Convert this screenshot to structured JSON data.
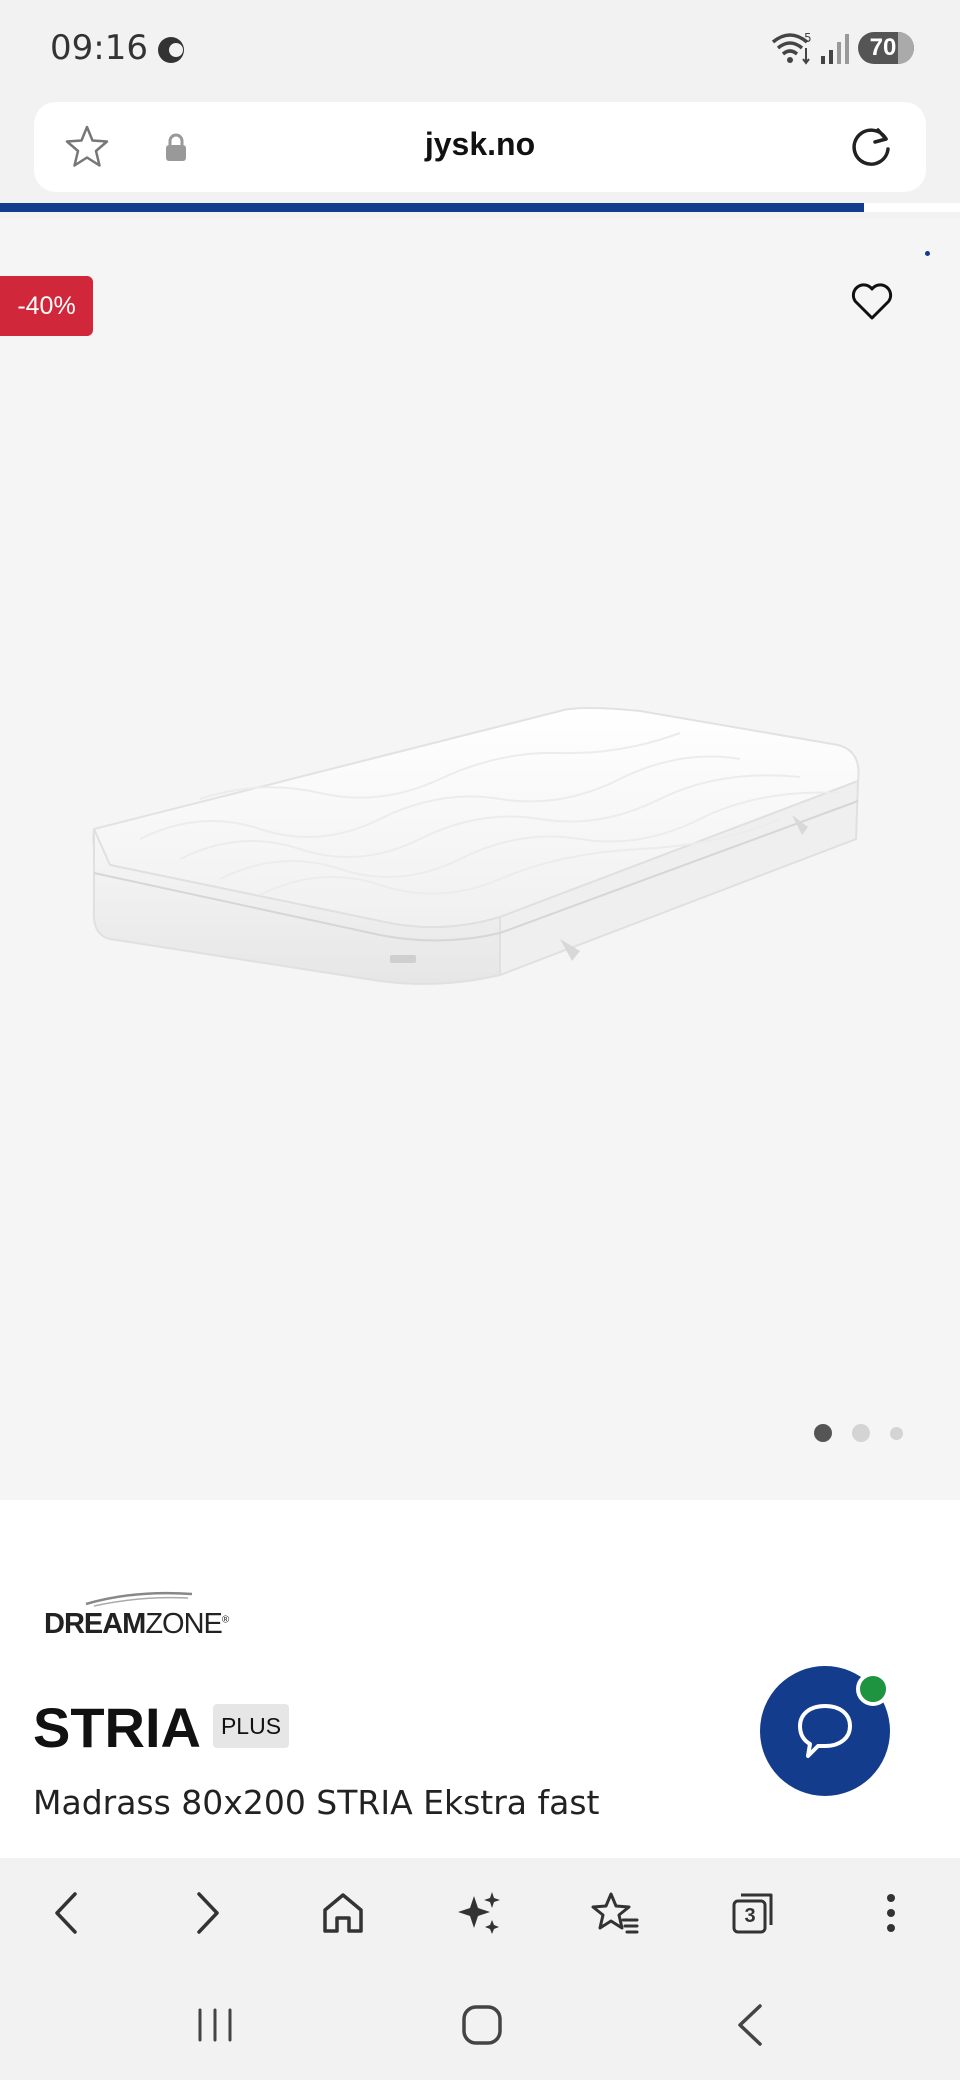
{
  "status_bar": {
    "time": "09:16",
    "wifi_label": "5",
    "battery": "70"
  },
  "address_bar": {
    "url": "jysk.no"
  },
  "page_load_progress": 0.9,
  "gallery": {
    "discount_badge": "-40%",
    "image_count": 3,
    "active_image_index": 0
  },
  "product": {
    "brand": "DREAMZONE",
    "brand_bold": "DREAM",
    "brand_light": "ZONE",
    "title": "STRIA",
    "tag": "PLUS",
    "subtitle": "Madrass 80x200 STRIA Ekstra fast"
  },
  "browser_toolbar": {
    "tab_count": "3",
    "icons": [
      "back-icon",
      "forward-icon",
      "home-icon",
      "ai-sparkle-icon",
      "bookmarks-icon",
      "tabs-icon",
      "more-icon"
    ]
  },
  "colors": {
    "accent": "#143c8c",
    "discount": "#d0283a",
    "chat_notify": "#1e9440"
  }
}
